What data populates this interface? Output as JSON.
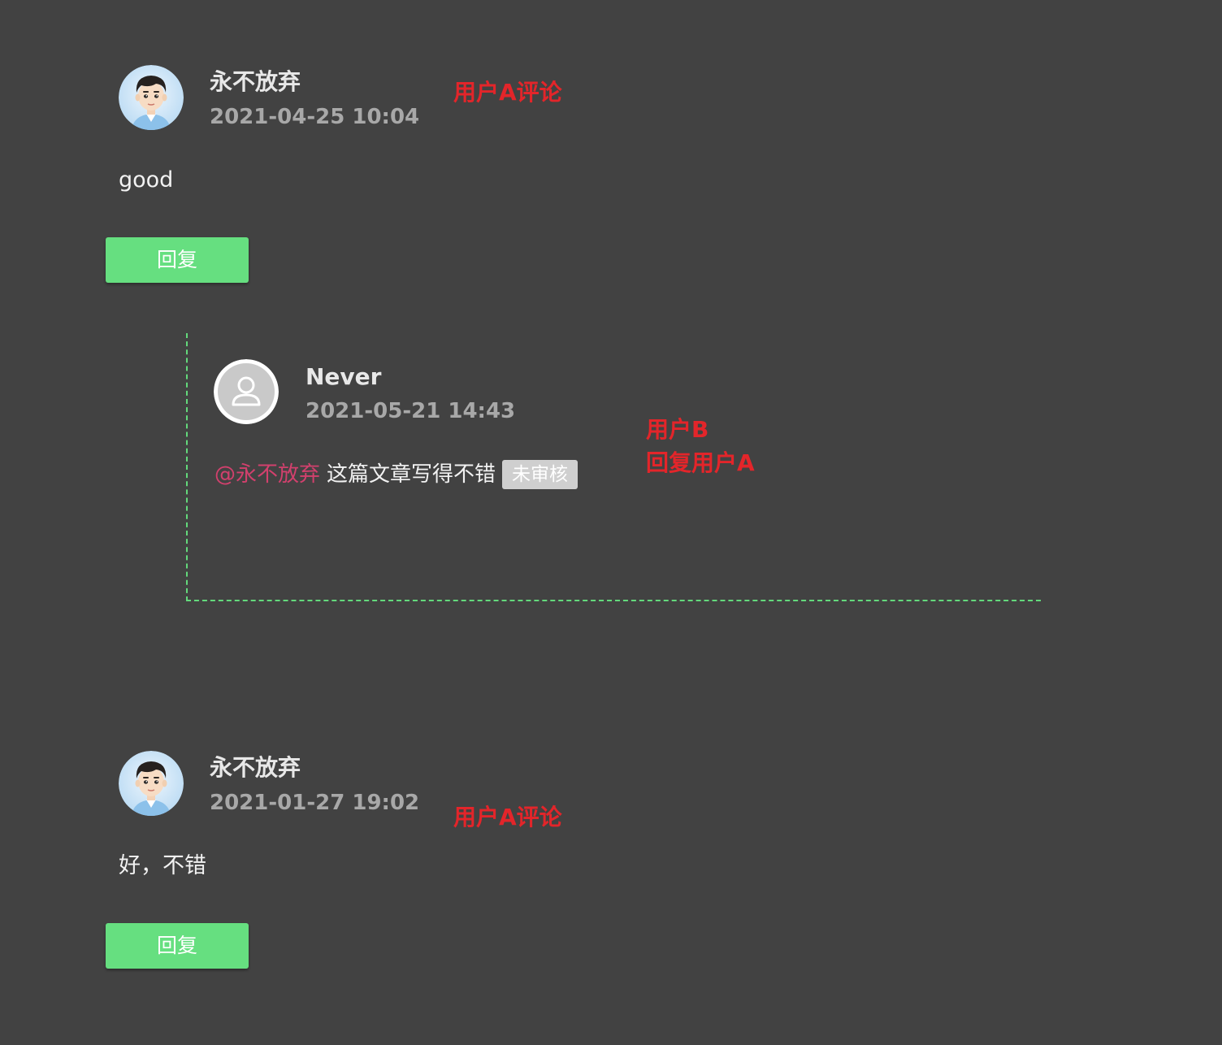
{
  "comments": [
    {
      "username": "永不放弃",
      "timestamp": "2021-04-25 10:04",
      "body": "good",
      "reply_label": "回复",
      "annotation": "用户A评论"
    },
    {
      "username": "永不放弃",
      "timestamp": "2021-01-27 19:02",
      "body": "好，不错",
      "reply_label": "回复",
      "annotation": "用户A评论"
    }
  ],
  "reply": {
    "username": "Never",
    "timestamp": "2021-05-21 14:43",
    "mention": "@永不放弃",
    "content": "这篇文章写得不错",
    "status": "未审核",
    "annotation_line1": "用户B",
    "annotation_line2": "回复用户A"
  },
  "icons": {
    "user_a_avatar": "cartoon-boy-avatar",
    "user_b_avatar": "default-user-avatar"
  },
  "colors": {
    "background": "#424242",
    "reply_button": "#66df80",
    "reply_border": "#63d97c",
    "mention": "#d2406d",
    "annotation": "#e3252a",
    "status_badge": "#cfcfcf"
  }
}
